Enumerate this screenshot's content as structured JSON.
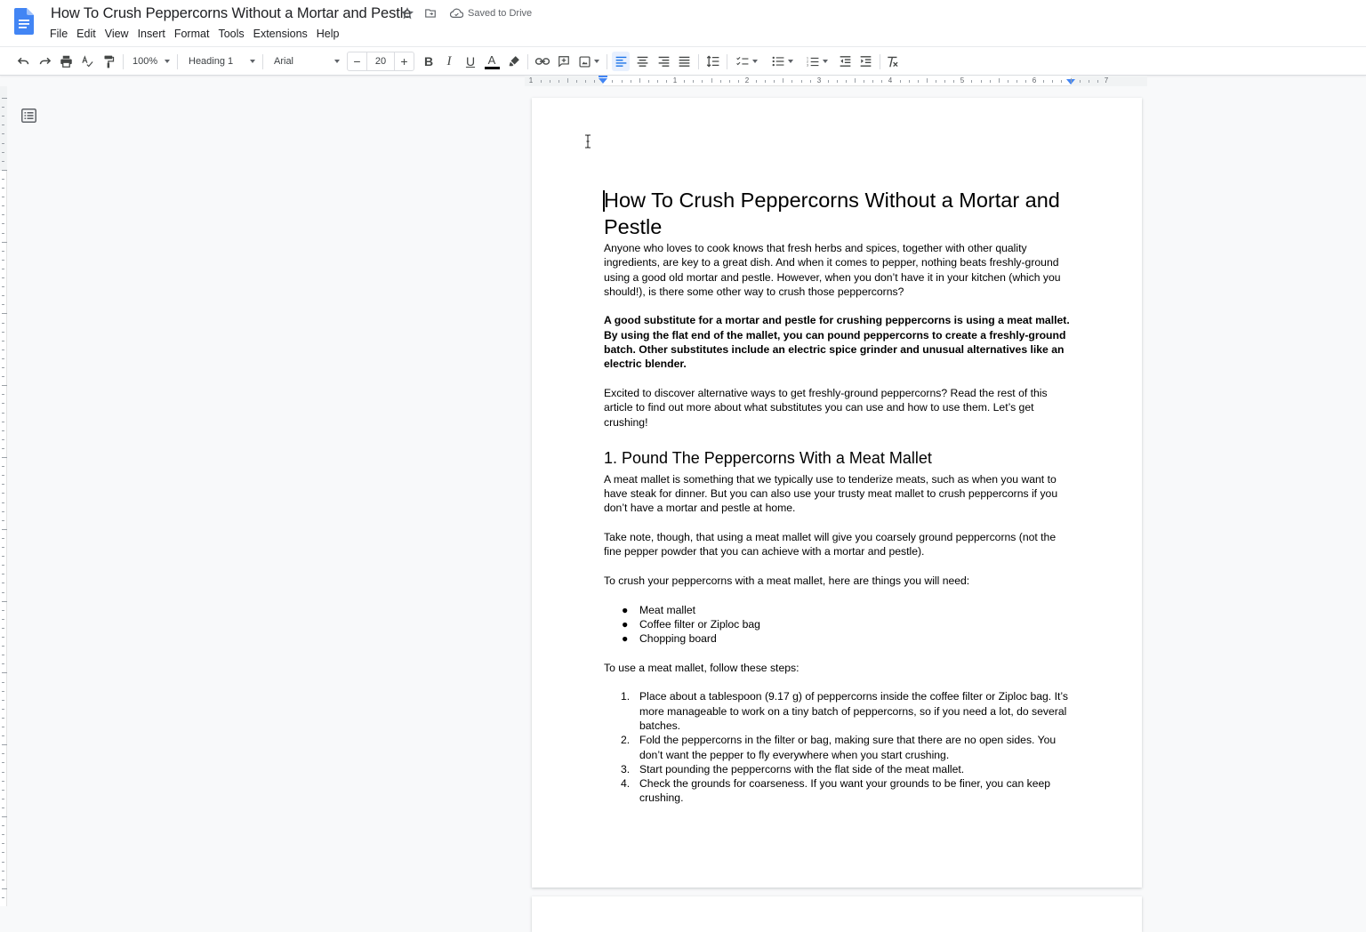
{
  "app": {
    "doc_title": "How To Crush Peppercorns Without a Mortar and Pestle",
    "save_status": "Saved to Drive",
    "icons": {
      "logo": "google-docs-logo-icon",
      "star": "star-icon",
      "move": "move-to-folder-icon",
      "cloud": "cloud-saved-icon"
    }
  },
  "menu": [
    "File",
    "Edit",
    "View",
    "Insert",
    "Format",
    "Tools",
    "Extensions",
    "Help"
  ],
  "toolbar": {
    "zoom": "100%",
    "style": "Heading 1",
    "font": "Arial",
    "font_size": "20",
    "minus": "−",
    "plus": "+",
    "text_color": "#000000",
    "active_align": "left"
  },
  "ruler": {
    "labels": [
      "1",
      "1",
      "2",
      "3",
      "4",
      "5",
      "6",
      "7"
    ]
  },
  "document": {
    "title": "How To Crush Peppercorns Without a Mortar and Pestle",
    "intro": "Anyone who loves to cook knows that fresh herbs and spices, together with other quality ingredients, are key to a great dish. And when it comes to pepper, nothing beats freshly-ground using a good old mortar and pestle. However, when you don’t have it in your kitchen (which you should!), is there some other way to crush those peppercorns?",
    "summary_bold": "A good substitute for a mortar and pestle for crushing peppercorns is using a meat mallet. By using the flat end of the mallet, you can pound peppercorns to create a freshly-ground batch. Other substitutes include an electric spice grinder and unusual alternatives like an electric blender.",
    "teaser": "Excited to discover alternative ways to get freshly-ground peppercorns? Read the rest of this article to find out more about what substitutes you can use and how to use them. Let’s get crushing!",
    "section1": {
      "heading": "1. Pound The Peppercorns With a Meat Mallet",
      "p1": "A meat mallet is something that we typically use to tenderize meats, such as when you want to have steak for dinner. But you can also use your trusty meat mallet to crush peppercorns if you don’t have a mortar and pestle at home.",
      "p2": "Take note, though, that using a meat mallet will give you coarsely ground peppercorns (not the fine pepper powder that you can achieve with a mortar and pestle).",
      "p3": "To crush your peppercorns with a meat mallet, here are things you will need:",
      "needs": [
        "Meat mallet",
        "Coffee filter or Ziploc bag",
        "Chopping board"
      ],
      "p4": "To use a meat mallet, follow these steps:",
      "steps": [
        {
          "n": "1.",
          "text": "Place about a tablespoon (9.17 g) of peppercorns inside the coffee filter or Ziploc bag. It’s more manageable to work on a tiny batch of peppercorns, so if you need a lot, do several batches."
        },
        {
          "n": "2.",
          "text": "Fold the peppercorns in the filter or bag, making sure that there are no open sides. You don’t want the pepper to fly everywhere when you start crushing."
        },
        {
          "n": "3.",
          "text": "Start pounding the peppercorns with the flat side of the meat mallet."
        },
        {
          "n": "4.",
          "text": "Check the grounds for coarseness. If you want your grounds to be finer, you can keep crushing."
        }
      ]
    }
  },
  "colors": {
    "brand_blue": "#4285f4",
    "active_bg": "#e8f0fe",
    "active_fg": "#1a73e8"
  }
}
